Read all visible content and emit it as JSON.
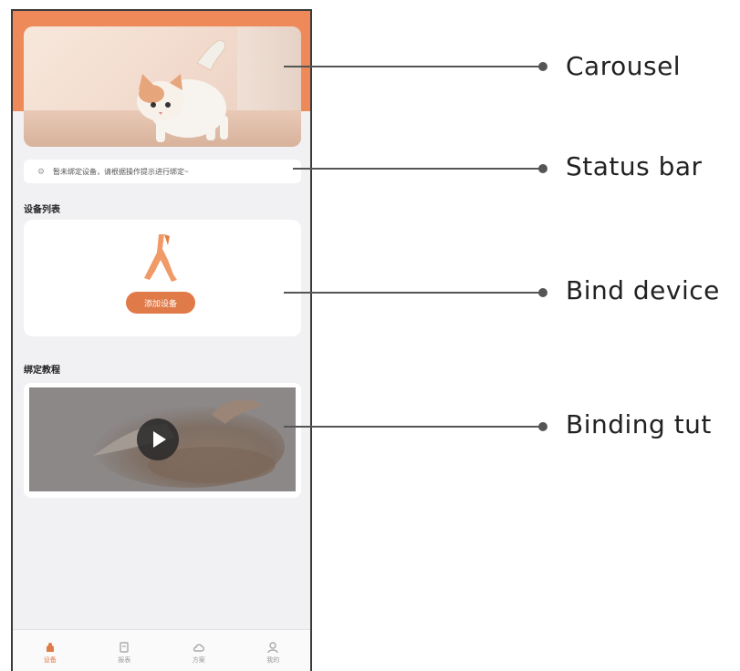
{
  "status_bar": {
    "text": "暂未绑定设备，请根据操作提示进行绑定~"
  },
  "device_list": {
    "title": "设备列表",
    "add_button": "添加设备"
  },
  "tutorial": {
    "title": "绑定教程"
  },
  "tabs": [
    {
      "label": "设备",
      "icon": "device-icon",
      "active": true
    },
    {
      "label": "报表",
      "icon": "report-icon",
      "active": false
    },
    {
      "label": "方案",
      "icon": "cloud-icon",
      "active": false
    },
    {
      "label": "我的",
      "icon": "profile-icon",
      "active": false
    }
  ],
  "annotations": [
    {
      "label": "Carousel"
    },
    {
      "label": "Status bar"
    },
    {
      "label": "Bind device"
    },
    {
      "label": "Binding tut"
    }
  ],
  "colors": {
    "accent": "#e17a49",
    "header": "#ee8a5a",
    "background": "#f1f1f3"
  }
}
